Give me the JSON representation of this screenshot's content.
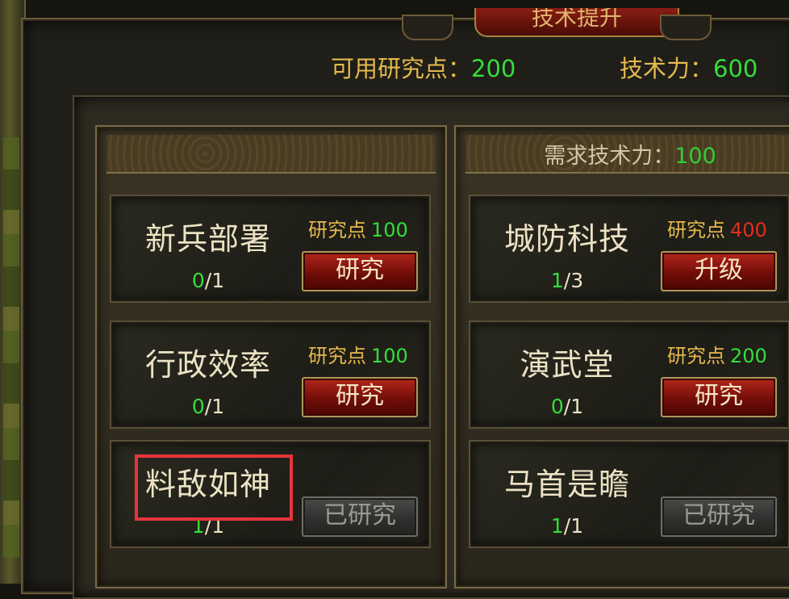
{
  "title": "技术提升",
  "stats": {
    "points_label": "可用研究点：",
    "points_value": "200",
    "tech_label": "技术力：",
    "tech_value": "600"
  },
  "right_column": {
    "need_label": "需求技术力：",
    "need_value": "100"
  },
  "cost_label": "研究点",
  "cards": [
    {
      "name": "新兵部署",
      "current": "0",
      "max": "/1",
      "cost": "100",
      "cost_color": "#33de3a",
      "button": "研究",
      "state": "available"
    },
    {
      "name": "行政效率",
      "current": "0",
      "max": "/1",
      "cost": "100",
      "cost_color": "#33de3a",
      "button": "研究",
      "state": "available"
    },
    {
      "name": "料敌如神",
      "current": "1",
      "max": "/1",
      "cost": "",
      "button": "已研究",
      "state": "done"
    },
    {
      "name": "城防科技",
      "current": "1",
      "max": "/3",
      "cost": "400",
      "cost_color": "#e62d1f",
      "button": "升级",
      "state": "upgrade"
    },
    {
      "name": "演武堂",
      "current": "0",
      "max": "/1",
      "cost": "200",
      "cost_color": "#33de3a",
      "button": "研究",
      "state": "available"
    },
    {
      "name": "马首是瞻",
      "current": "1",
      "max": "/1",
      "cost": "",
      "button": "已研究",
      "state": "done"
    }
  ],
  "colors": {
    "green": "#33de3a",
    "red": "#e62d1f",
    "gold": "#e5b94c",
    "highlight": "#e8343c"
  }
}
